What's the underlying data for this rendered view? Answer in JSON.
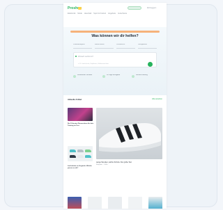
{
  "site": {
    "logo_text": "Proshop",
    "login_label": "Einloggen"
  },
  "nav": {
    "items": [
      "Elektronik",
      "Mode",
      "Haushalt",
      "Sport & Freizeit",
      "Angebote",
      "Gutscheine"
    ]
  },
  "hero": {
    "title": "Was können wir dir helfen?",
    "fields": [
      {
        "label": "Produktkategorie"
      },
      {
        "label": "Marke wählen"
      },
      {
        "label": "Preisbereich"
      },
      {
        "label": "Verfügbarkeit"
      }
    ],
    "input_placeholder": "Wonach suchst du?",
    "input_hint": "z. B. Laufschuhe, Kopfhörer, Kaffeemaschine",
    "features": [
      "Kostenloser Versand",
      "30 Tage Rückgabe",
      "Sichere Zahlung"
    ]
  },
  "section": {
    "title": "Aktuelle Artikel",
    "link": "Alle ansehen"
  },
  "articles": [
    {
      "title": "Die 10 besten Fitnessuhren für dein Training im Test"
    },
    {
      "title": "Laufschuhe im Vergleich: Welche passen zu dir?"
    }
  ],
  "feature_article": {
    "caption": "Lange Strecken, leichte Schuhe: Der große Test",
    "sub": "Ratgeber · 5 Min."
  },
  "colors": {
    "accent": "#27b35d",
    "promo": "#f6b27a"
  }
}
